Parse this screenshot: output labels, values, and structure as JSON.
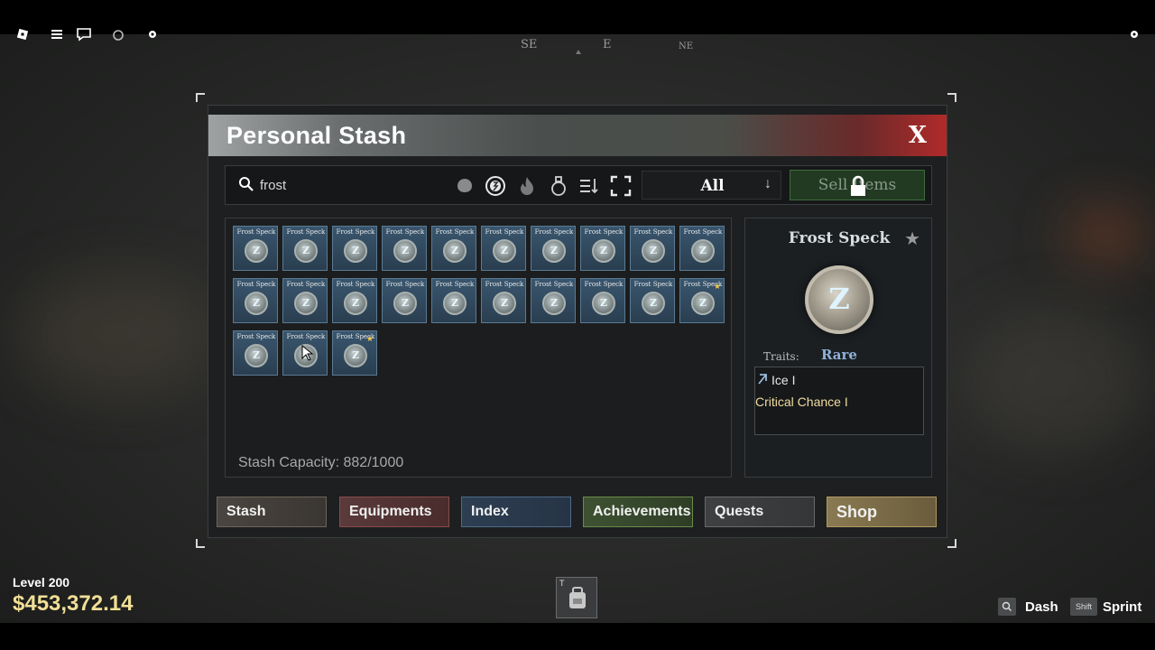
{
  "window": {
    "title": "Personal Stash",
    "close_label": "X"
  },
  "toolbar": {
    "search_value": "frost",
    "filter_value": "All",
    "sell_label": "Sell Items",
    "tool_icons": [
      "blob-filter-icon",
      "coin-filter-icon",
      "fire-filter-icon",
      "potion-filter-icon",
      "sort-icon",
      "expand-icon"
    ]
  },
  "stash": {
    "item_name": "Frost Speck",
    "capacity": "Stash Capacity: 882/1000",
    "rows": [
      [
        false,
        false,
        false,
        false,
        false,
        false,
        false,
        false,
        false,
        false
      ],
      [
        false,
        false,
        false,
        false,
        false,
        false,
        false,
        false,
        false,
        true
      ],
      [
        false,
        false,
        true
      ]
    ]
  },
  "detail": {
    "name": "Frost Speck",
    "rarity": "Rare",
    "traits_label": "Traits:",
    "traits": [
      "Ice I",
      "Critical Chance I"
    ]
  },
  "nav": {
    "stash": "Stash",
    "equipments": "Equipments",
    "index": "Index",
    "achievements": "Achievements",
    "quests": "Quests",
    "shop": "Shop"
  },
  "compass": {
    "se": "SE",
    "e": "E",
    "ne": "NE"
  },
  "hud": {
    "level": "Level 200",
    "money": "$453,372.14",
    "hotbar_key": "T",
    "dash_key": "Q",
    "dash_label": "Dash",
    "sprint_key": "Shift",
    "sprint_label": "Sprint"
  },
  "colors": {
    "money": "#f1df96",
    "rarity_rare": "#8fb1d8",
    "close_red": "#b02a2a"
  }
}
